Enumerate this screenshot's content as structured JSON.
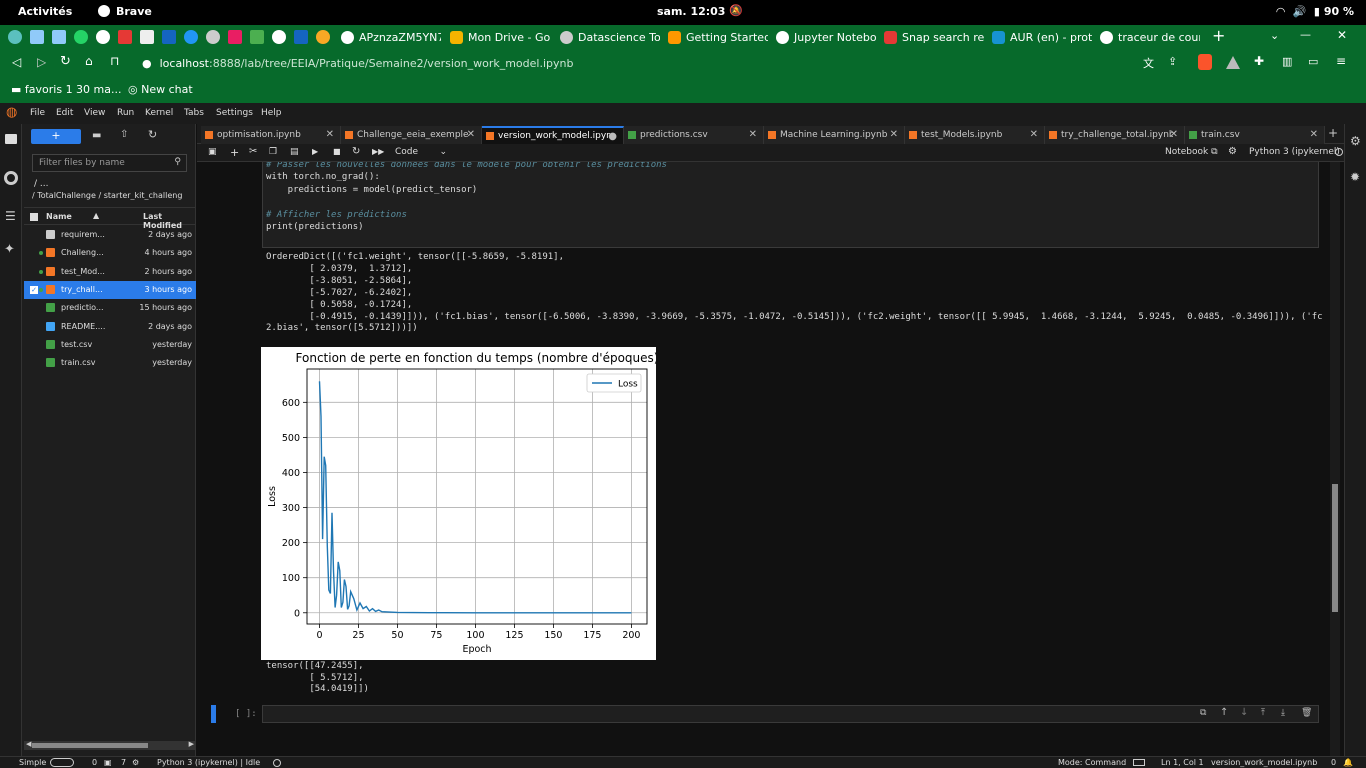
{
  "os_bar": {
    "activities": "Activités",
    "app": "Brave",
    "clock": "sam. 12:03",
    "battery": "90 %"
  },
  "browser_tabs": [
    {
      "label": "APznzaZM5YN7",
      "color": "#ffffff"
    },
    {
      "label": "Mon Drive - Go",
      "color": "#f4b400"
    },
    {
      "label": "Datascience To",
      "color": "#cccccc"
    },
    {
      "label": "Getting Started",
      "color": "#ff9800"
    },
    {
      "label": "Jupyter Notebo",
      "color": "#ffffff"
    },
    {
      "label": "Snap search re",
      "color": "#e53935"
    },
    {
      "label": "AUR (en) - prot",
      "color": "#1793d1"
    },
    {
      "label": "traceur de cour",
      "color": "#ffffff"
    }
  ],
  "address": {
    "host": "localhost",
    "path": ":8888/lab/tree/EEIA/Pratique/Semaine2/version_work_model.ipynb"
  },
  "bookmarks": {
    "folder": "favoris 1 30 ma...",
    "chat": "New chat"
  },
  "menu": [
    "File",
    "Edit",
    "View",
    "Run",
    "Kernel",
    "Tabs",
    "Settings",
    "Help"
  ],
  "filebrowser": {
    "filter_placeholder": "Filter files by name",
    "breadcrumb1": "/ ...",
    "breadcrumb2": "/ TotalChallenge / starter_kit_challeng",
    "col_name": "Name",
    "col_modified": "Last Modified",
    "files": [
      {
        "name": "requirem...",
        "modified": "2 days ago",
        "type": "folder",
        "running": false,
        "selected": false
      },
      {
        "name": "Challeng...",
        "modified": "4 hours ago",
        "type": "notebook",
        "running": true,
        "selected": false
      },
      {
        "name": "test_Mod...",
        "modified": "2 hours ago",
        "type": "notebook",
        "running": true,
        "selected": false
      },
      {
        "name": "try_chall...",
        "modified": "3 hours ago",
        "type": "notebook",
        "running": true,
        "selected": true
      },
      {
        "name": "predictio...",
        "modified": "15 hours ago",
        "type": "csv",
        "running": false,
        "selected": false
      },
      {
        "name": "README....",
        "modified": "2 days ago",
        "type": "md",
        "running": false,
        "selected": false
      },
      {
        "name": "test.csv",
        "modified": "yesterday",
        "type": "csv",
        "running": false,
        "selected": false
      },
      {
        "name": "train.csv",
        "modified": "yesterday",
        "type": "csv",
        "running": false,
        "selected": false
      }
    ]
  },
  "doc_tabs": [
    {
      "label": "optimisation.ipynb",
      "active": false
    },
    {
      "label": "Challenge_eeia_exemple.i",
      "active": false
    },
    {
      "label": "version_work_model.ipyn",
      "active": true
    },
    {
      "label": "predictions.csv",
      "active": false
    },
    {
      "label": "Machine Learning.ipynb",
      "active": false
    },
    {
      "label": "test_Models.ipynb",
      "active": false
    },
    {
      "label": "try_challenge_total.ipynb",
      "active": false
    },
    {
      "label": "train.csv",
      "active": false
    }
  ],
  "toolbar": {
    "cell_type": "Code",
    "notebook_link": "Notebook",
    "kernel": "Python 3 (ipykernel)"
  },
  "code_cell": {
    "lines": [
      "# Passer les nouvelles données dans le modèle pour obtenir les prédictions",
      "with torch.no_grad():",
      "    predictions = model(predict_tensor)",
      "",
      "# Afficher les prédictions",
      "print(predictions)"
    ]
  },
  "output_text": [
    "OrderedDict([('fc1.weight', tensor([[-5.8659, -5.8191],",
    "        [ 2.0379,  1.3712],",
    "        [-3.8051, -2.5864],",
    "        [-5.7027, -6.2402],",
    "        [ 0.5058, -0.1724],",
    "        [-0.4915, -0.1439]])), ('fc1.bias', tensor([-6.5006, -3.8390, -3.9669, -5.3575, -1.0472, -0.5145])), ('fc2.weight', tensor([[ 5.9945,  1.4668, -3.1244,  5.9245,  0.0485, -0.3496]])), ('fc",
    "2.bias', tensor([5.5712]))])"
  ],
  "output_tensor": [
    "tensor([[47.2455],",
    "        [ 5.5712],",
    "        [54.0419]])"
  ],
  "empty_prompt": "[ ]:",
  "chart_data": {
    "type": "line",
    "title": "Fonction de perte en fonction du temps (nombre d'époques)",
    "xlabel": "Epoch",
    "ylabel": "Loss",
    "xlim": [
      -8,
      210
    ],
    "ylim": [
      -32,
      695
    ],
    "xticks": [
      0,
      25,
      50,
      75,
      100,
      125,
      150,
      175,
      200
    ],
    "yticks": [
      0,
      100,
      200,
      300,
      400,
      500,
      600
    ],
    "grid": true,
    "legend": "top-right",
    "color": "#1f77b4",
    "series": [
      {
        "name": "Loss",
        "x": [
          0,
          1,
          2,
          3,
          4,
          5,
          6,
          7,
          8,
          9,
          10,
          11,
          12,
          13,
          14,
          15,
          16,
          17,
          18,
          19,
          20,
          22,
          24,
          26,
          28,
          30,
          32,
          34,
          36,
          38,
          40,
          45,
          50,
          60,
          70,
          80,
          100,
          150,
          200
        ],
        "values": [
          660,
          560,
          210,
          445,
          420,
          190,
          65,
          55,
          285,
          120,
          15,
          50,
          145,
          120,
          15,
          30,
          95,
          75,
          10,
          20,
          60,
          40,
          8,
          28,
          12,
          18,
          5,
          12,
          4,
          8,
          3,
          2,
          1,
          0.5,
          0.2,
          0.1,
          0.05,
          0.02,
          0.01
        ]
      }
    ]
  },
  "status": {
    "mode_label": "Simple",
    "terminals": "0",
    "kernels": "7",
    "kernel": "Python 3 (ipykernel) | Idle",
    "mode": "Mode: Command",
    "position": "Ln 1, Col 1",
    "file": "version_work_model.ipynb",
    "notifications": "0"
  }
}
